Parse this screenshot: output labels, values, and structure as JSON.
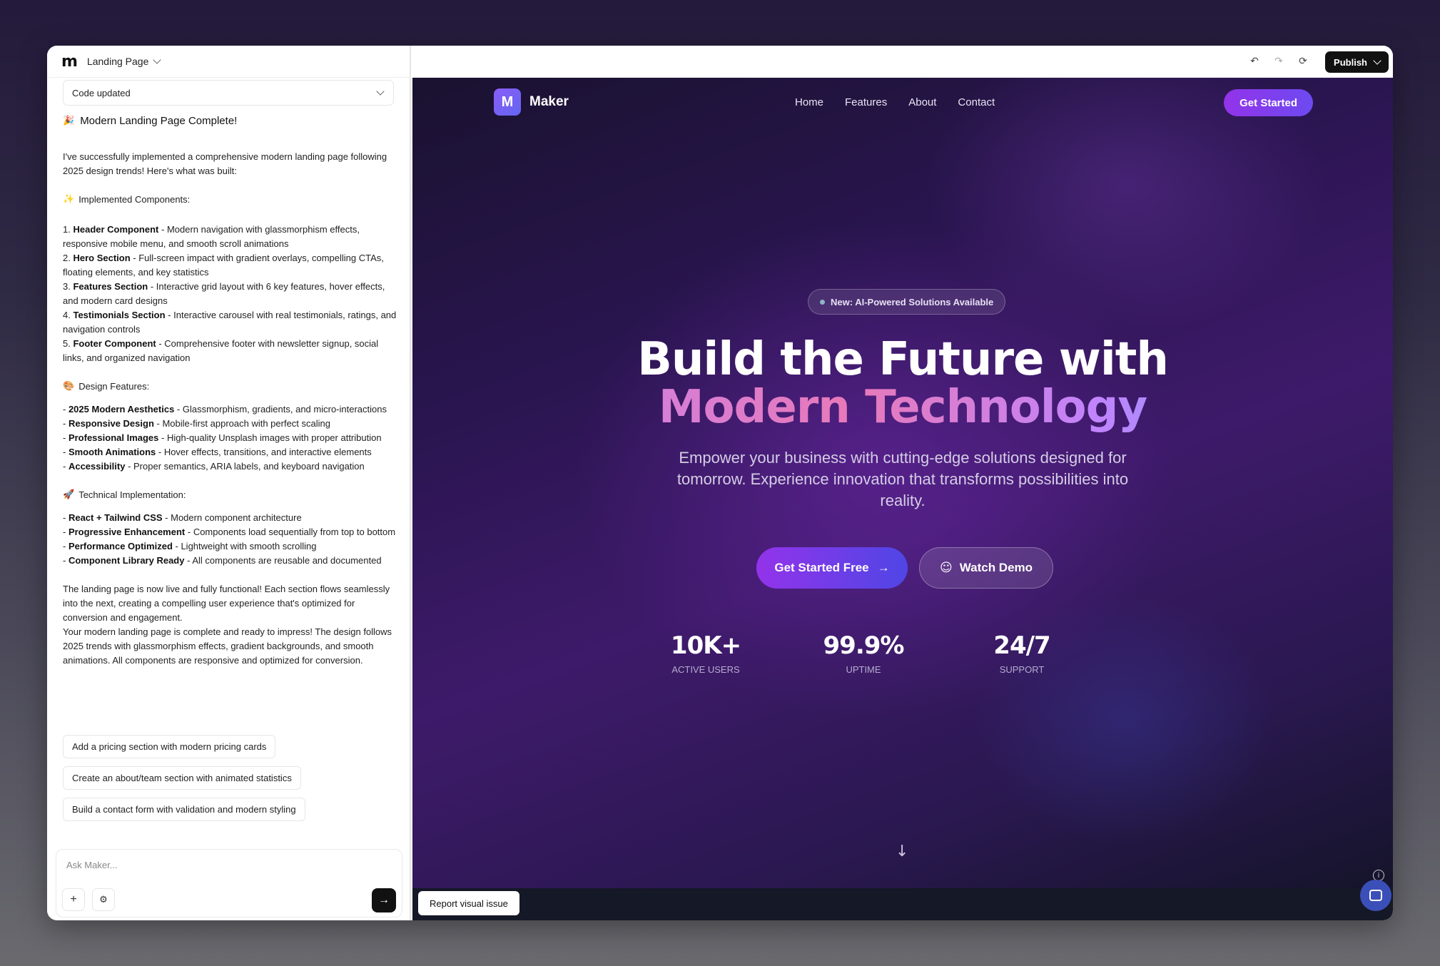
{
  "app": {
    "project_name": "Landing Page",
    "status_label": "Code updated"
  },
  "chat": {
    "title_emoji": "🎉",
    "title": "Modern Landing Page Complete!",
    "intro": "I've successfully implemented a comprehensive modern landing page following 2025 design trends! Here's what was built:",
    "implemented_emoji": "✨",
    "implemented_heading": "Implemented Components:",
    "components": [
      {
        "name": "Header Component",
        "desc": "Modern navigation with glassmorphism effects, responsive mobile menu, and smooth scroll animations"
      },
      {
        "name": "Hero Section",
        "desc": "Full-screen impact with gradient overlays, compelling CTAs, floating elements, and key statistics"
      },
      {
        "name": "Features Section",
        "desc": "Interactive grid layout with 6 key features, hover effects, and modern card designs"
      },
      {
        "name": "Testimonials Section",
        "desc": "Interactive carousel with real testimonials, ratings, and navigation controls"
      },
      {
        "name": "Footer Component",
        "desc": "Comprehensive footer with newsletter signup, social links, and organized navigation"
      }
    ],
    "design_emoji": "🎨",
    "design_heading": "Design Features:",
    "design": [
      {
        "name": "2025 Modern Aesthetics",
        "desc": "Glassmorphism, gradients, and micro-interactions"
      },
      {
        "name": "Responsive Design",
        "desc": "Mobile-first approach with perfect scaling"
      },
      {
        "name": "Professional Images",
        "desc": "High-quality Unsplash images with proper attribution"
      },
      {
        "name": "Smooth Animations",
        "desc": "Hover effects, transitions, and interactive elements"
      },
      {
        "name": "Accessibility",
        "desc": "Proper semantics, ARIA labels, and keyboard navigation"
      }
    ],
    "tech_emoji": "🚀",
    "tech_heading": "Technical Implementation:",
    "tech": [
      {
        "name": "React + Tailwind CSS",
        "desc": "Modern component architecture"
      },
      {
        "name": "Progressive Enhancement",
        "desc": "Components load sequentially from top to bottom"
      },
      {
        "name": "Performance Optimized",
        "desc": "Lightweight with smooth scrolling"
      },
      {
        "name": "Component Library Ready",
        "desc": "All components are reusable and documented"
      }
    ],
    "outro1": "The landing page is now live and fully functional! Each section flows seamlessly into the next, creating a compelling user experience that's optimized for conversion and engagement.",
    "outro2": "Your modern landing page is complete and ready to impress! The design follows 2025 trends with glassmorphism effects, gradient backgrounds, and smooth animations. All components are responsive and optimized for conversion.",
    "suggestions": [
      "Add a pricing section with modern pricing cards",
      "Create an about/team section with animated statistics",
      "Build a contact form with validation and modern styling"
    ],
    "input_placeholder": "Ask Maker..."
  },
  "toolbar": {
    "publish_label": "Publish"
  },
  "preview": {
    "brand_letter": "M",
    "brand_name": "Maker",
    "nav": [
      "Home",
      "Features",
      "About",
      "Contact"
    ],
    "nav_cta": "Get Started",
    "badge": "New: AI-Powered Solutions Available",
    "headline_1": "Build the Future with",
    "headline_2": "Modern Technology",
    "subtitle": "Empower your business with cutting-edge solutions designed for tomorrow. Experience innovation that transforms possibilities into reality.",
    "cta_primary": "Get Started Free",
    "cta_secondary": "Watch Demo",
    "stats": [
      {
        "value": "10K+",
        "label": "ACTIVE USERS"
      },
      {
        "value": "99.9%",
        "label": "UPTIME"
      },
      {
        "value": "24/7",
        "label": "SUPPORT"
      }
    ]
  },
  "footer": {
    "report_label": "Report visual issue"
  }
}
